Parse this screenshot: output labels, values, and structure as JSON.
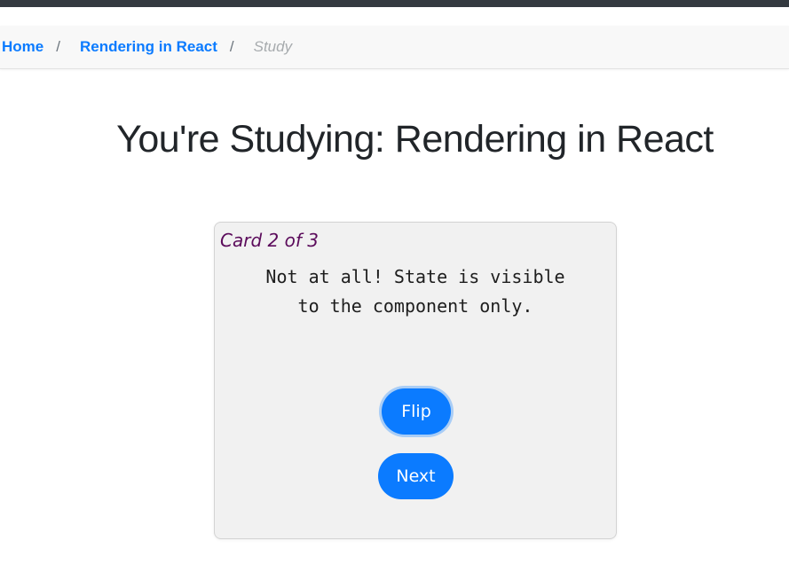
{
  "breadcrumb": {
    "home": "Home",
    "separator": "/",
    "deck": "Rendering in React",
    "current": "Study"
  },
  "page_title": "You're Studying: Rendering in React",
  "card": {
    "counter": "Card 2 of 3",
    "text": "Not at all! State is visible to the component only."
  },
  "buttons": {
    "flip": "Flip",
    "next": "Next"
  },
  "colors": {
    "accent": "#0b7bff",
    "counter_text": "#5b0b5b",
    "topbar": "#343a40"
  }
}
